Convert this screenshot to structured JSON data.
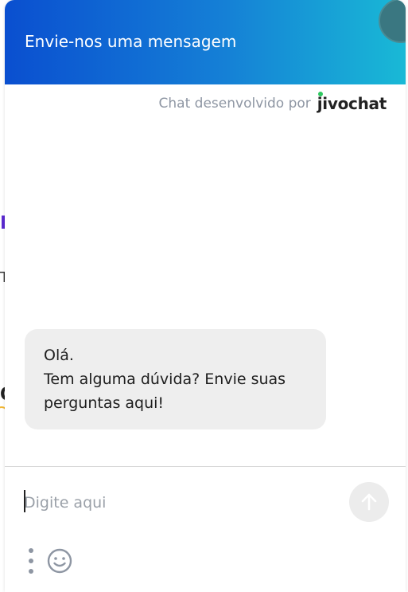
{
  "background": {
    "fragment_1": "P",
    "fragment_2": "TE",
    "fragment_3": "O"
  },
  "chat": {
    "header_title": "Envie-nos uma mensagem",
    "branding_text": "Chat desenvolvido por",
    "brand_name": "jivochat",
    "message_lines": [
      "Olá.",
      "Tem alguma dúvida? Envie suas perguntas aqui!"
    ],
    "input_placeholder": "Digite aqui",
    "input_value": ""
  },
  "icons": {
    "send": "arrow-up-icon",
    "more": "vertical-dots-icon",
    "emoji": "smiley-icon"
  },
  "colors": {
    "header_gradient_start": "#0a4fd0",
    "header_gradient_end": "#19b9d6",
    "bubble_bg": "#eeeeee",
    "brand_dot": "#2ec860",
    "icon_gray": "#8e96a3"
  }
}
